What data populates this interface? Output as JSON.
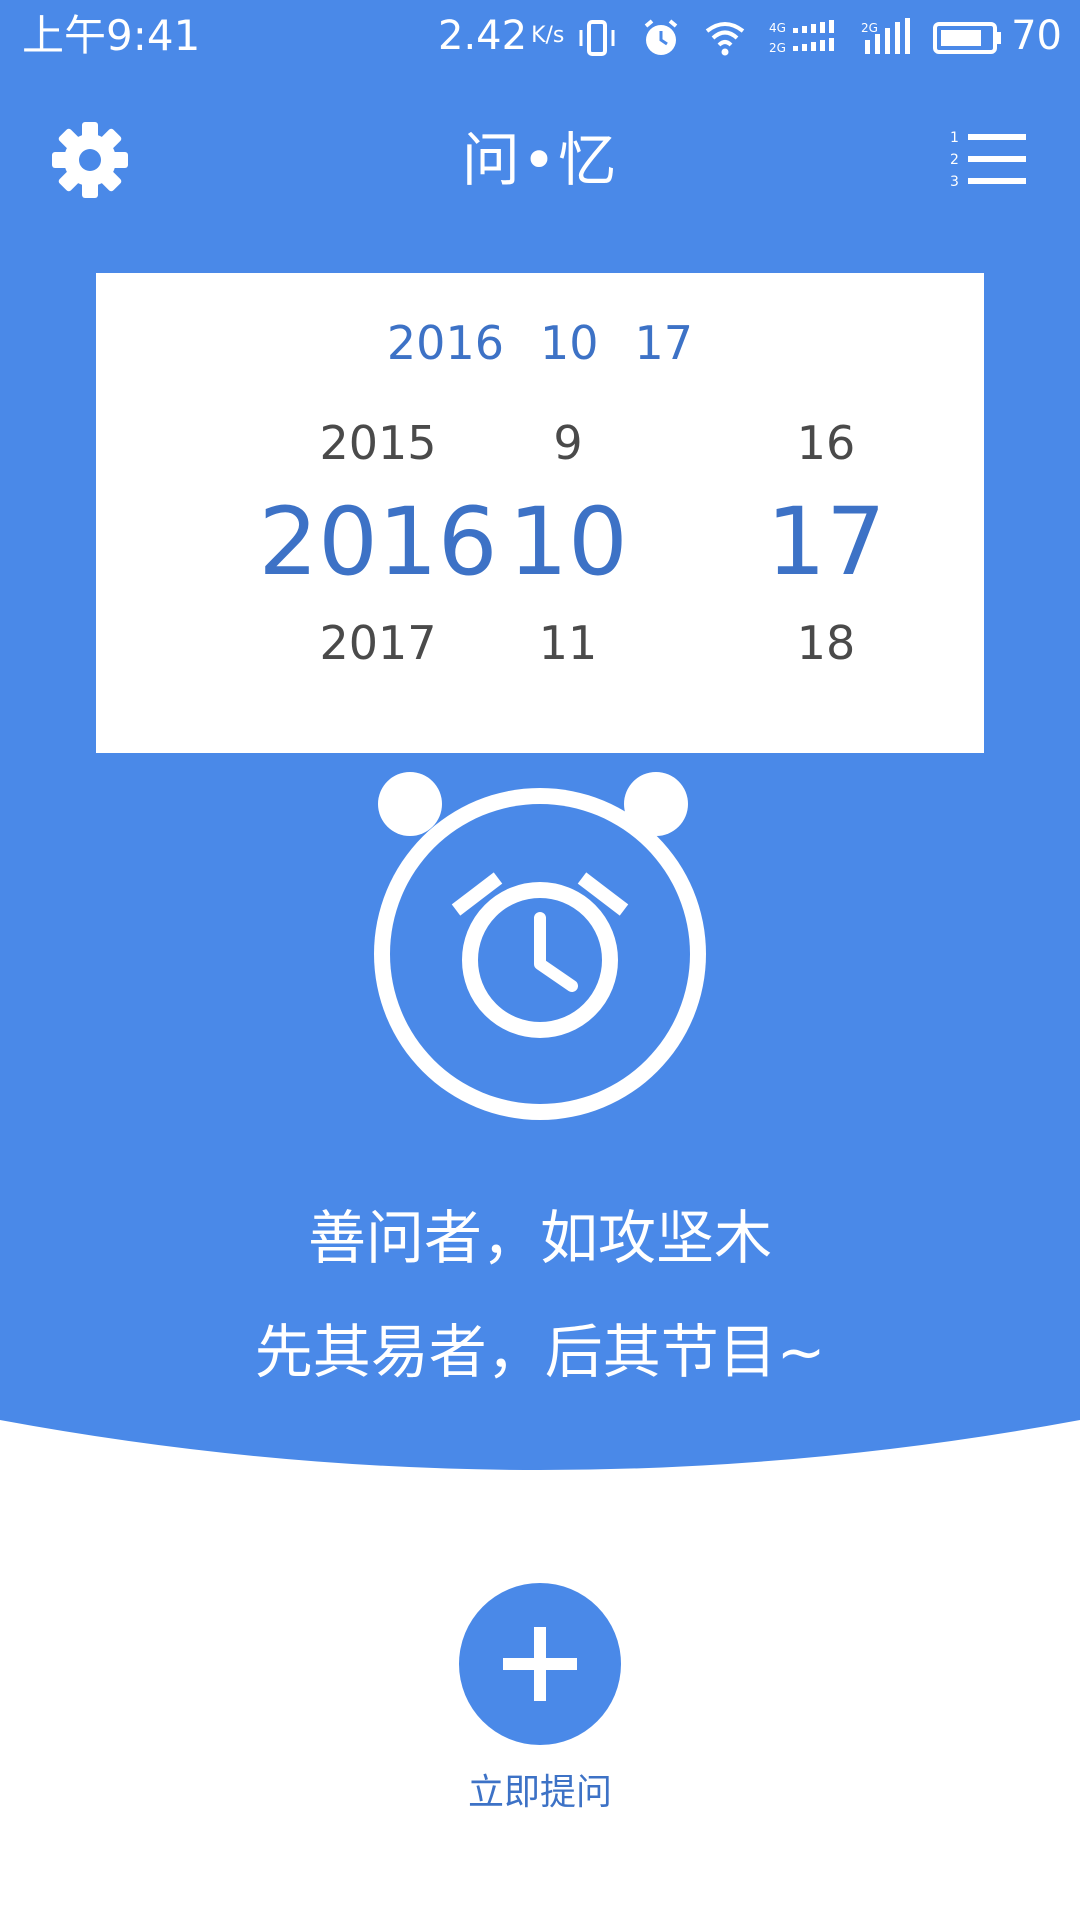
{
  "status_bar": {
    "time": "上午9:41",
    "net_speed": "2.42",
    "net_speed_unit": "K/s",
    "battery_level": "70"
  },
  "app_bar": {
    "title": "问•忆",
    "settings_icon": "gear-icon",
    "list_icon": "numbered-list-icon"
  },
  "date_picker": {
    "selected": {
      "year": "2016",
      "month": "10",
      "day": "17"
    },
    "year_wheel": {
      "prev": "2015",
      "current": "2016",
      "next": "2017"
    },
    "month_wheel": {
      "prev": "9",
      "current": "10",
      "next": "11"
    },
    "day_wheel": {
      "prev": "16",
      "current": "17",
      "next": "18"
    }
  },
  "alarm": {
    "icon": "alarm-clock-icon"
  },
  "quote": {
    "line1": "善问者，如攻坚木",
    "line2": "先其易者，后其节目~"
  },
  "fab": {
    "icon": "plus-icon",
    "label": "立即提问"
  },
  "colors": {
    "primary": "#4a89e8",
    "accent_text": "#3d72c6",
    "muted_text": "#4a4a4a",
    "background": "#ffffff"
  }
}
